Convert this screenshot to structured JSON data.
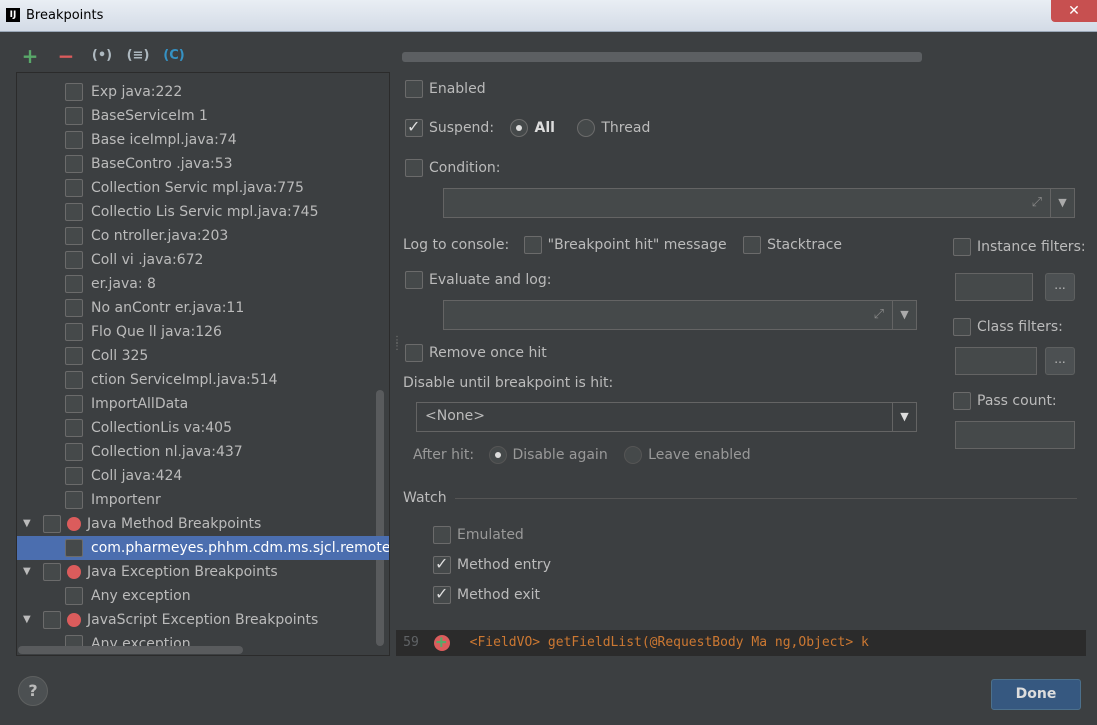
{
  "window": {
    "title": "Breakpoints",
    "icon_label": "IJ",
    "close_glyph": "✕"
  },
  "toolbar": {
    "add_glyph": "+",
    "remove_glyph": "−",
    "group_package_glyph": "(•)",
    "group_class_glyph": "(≡)",
    "group_file_glyph": "(C)"
  },
  "tree": {
    "items": [
      {
        "label": "Exp          java:222"
      },
      {
        "label": "BaseServiceIm        1"
      },
      {
        "label": "Base      iceImpl.java:74"
      },
      {
        "label": "BaseContro       .java:53"
      },
      {
        "label": "Collection    Servic   mpl.java:775"
      },
      {
        "label": "Collectio  Lis   Servic   mpl.java:745"
      },
      {
        "label": "Co            ntroller.java:203"
      },
      {
        "label": "Coll              vi        .java:672"
      },
      {
        "label": "                     er.java:  8"
      },
      {
        "label": "No            anContr    er.java:11"
      },
      {
        "label": "Flo   Que          ll     java:126"
      },
      {
        "label": "Coll                      325"
      },
      {
        "label": "        ction        ServiceImpl.java:514"
      },
      {
        "label": "ImportAllData"
      },
      {
        "label": "CollectionLis               va:405"
      },
      {
        "label": "Collection                  nl.java:437"
      },
      {
        "label": "Coll                    java:424"
      },
      {
        "label": "Importenr"
      }
    ],
    "java_method_group": "Java Method Breakpoints",
    "selected_item": "com.pharmeyes.phhm.cdm.ms.sjcl.remote.Xtg!RemoteService.getFieldList",
    "java_exception_group": "Java Exception Breakpoints",
    "java_any_exception": "Any exception",
    "js_exception_group": "JavaScript Exception Breakpoints",
    "js_any_exception": "Any exception"
  },
  "details": {
    "enabled_label": "Enabled",
    "suspend_label": "Suspend:",
    "suspend_all": "All",
    "suspend_thread": "Thread",
    "condition_label": "Condition:",
    "log_console_label": "Log to console:",
    "bp_hit_message": "\"Breakpoint hit\" message",
    "stacktrace_label": "Stacktrace",
    "evaluate_log_label": "Evaluate and log:",
    "remove_once_hit": "Remove once hit",
    "disable_until_label": "Disable until breakpoint is hit:",
    "disable_until_value": "<None>",
    "after_hit_label": "After hit:",
    "disable_again": "Disable again",
    "leave_enabled": "Leave enabled",
    "watch_label": "Watch",
    "emulated_label": "Emulated",
    "method_entry": "Method entry",
    "method_exit": "Method exit",
    "instance_filters": "Instance filters:",
    "class_filters": "Class filters:",
    "pass_count": "Pass count:",
    "more_glyph": "..."
  },
  "code": {
    "line_number": "59",
    "snippet": "<FieldVO> getFieldList(@RequestBody Ma        ng,Object> k"
  },
  "footer": {
    "help_glyph": "?",
    "done_label": "Done"
  }
}
